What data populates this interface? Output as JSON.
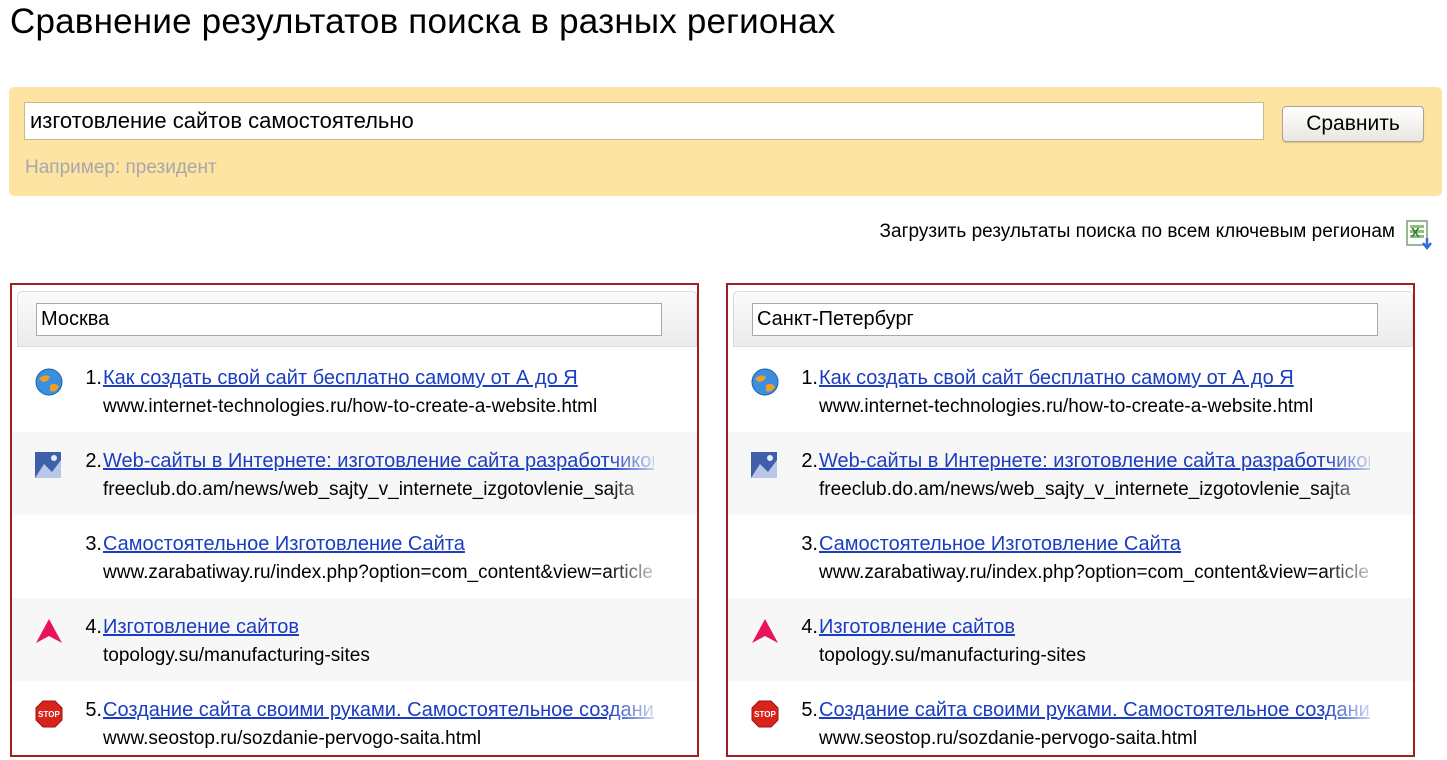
{
  "page": {
    "title": "Сравнение результатов поиска в разных регионах"
  },
  "search": {
    "query": "изготовление сайтов самостоятельно",
    "button_label": "Сравнить",
    "hint": "Например: президент"
  },
  "download": {
    "label": "Загрузить результаты поиска по всем ключевым регионам",
    "icon": "excel-download-icon"
  },
  "colors": {
    "search_panel_bg": "#fde4a3",
    "link": "#1a3dc1",
    "highlight_border": "#a61c1c"
  },
  "regions": [
    {
      "name": "Москва",
      "results": [
        {
          "num": "1.",
          "title": "Как создать свой сайт бесплатно самому от А до Я",
          "url": "www.internet-technologies.ru/how-to-create-a-website.html",
          "icon": "globe-icon"
        },
        {
          "num": "2.",
          "title": "Web-сайты в Интернете: изготовление сайта разработчиком",
          "url": "freeclub.do.am/news/web_sajty_v_internete_izgotovlenie_sajta",
          "icon": "photo-thumbnail-icon"
        },
        {
          "num": "3.",
          "title": "Самостоятельное Изготовление Сайта",
          "url": "www.zarabatiway.ru/index.php?option=com_content&view=article",
          "icon": ""
        },
        {
          "num": "4.",
          "title": "Изготовление сайтов",
          "url": "topology.su/manufacturing-sites",
          "icon": "pink-triangle-icon"
        },
        {
          "num": "5.",
          "title": "Создание сайта своими руками. Самостоятельное создание",
          "url": "www.seostop.ru/sozdanie-pervogo-saita.html",
          "icon": "stop-sign-icon"
        }
      ]
    },
    {
      "name": "Санкт-Петербург",
      "results": [
        {
          "num": "1.",
          "title": "Как создать свой сайт бесплатно самому от А до Я",
          "url": "www.internet-technologies.ru/how-to-create-a-website.html",
          "icon": "globe-icon"
        },
        {
          "num": "2.",
          "title": "Web-сайты в Интернете: изготовление сайта разработчиком",
          "url": "freeclub.do.am/news/web_sajty_v_internete_izgotovlenie_sajta",
          "icon": "photo-thumbnail-icon"
        },
        {
          "num": "3.",
          "title": "Самостоятельное Изготовление Сайта",
          "url": "www.zarabatiway.ru/index.php?option=com_content&view=article",
          "icon": ""
        },
        {
          "num": "4.",
          "title": "Изготовление сайтов",
          "url": "topology.su/manufacturing-sites",
          "icon": "pink-triangle-icon"
        },
        {
          "num": "5.",
          "title": "Создание сайта своими руками. Самостоятельное создание",
          "url": "www.seostop.ru/sozdanie-pervogo-saita.html",
          "icon": "stop-sign-icon"
        }
      ]
    }
  ]
}
